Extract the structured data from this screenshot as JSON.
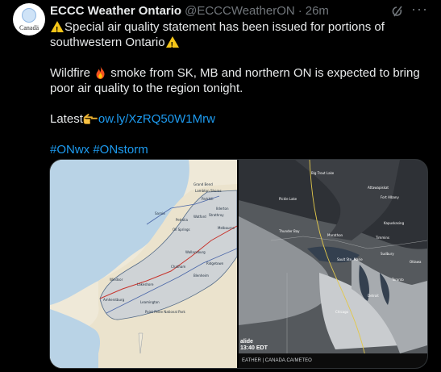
{
  "account": {
    "display_name": "ECCC Weather Ontario",
    "handle": "@ECCCWeatherON",
    "separator": "·",
    "timestamp": "26m",
    "avatar_brand": "Canadä"
  },
  "actions": {
    "grok_icon": "grok-icon",
    "more_icon": "more-icon",
    "more_glyph": "···"
  },
  "tweet": {
    "line1": "Special air quality statement has been issued for portions of",
    "line2": "southwestern Ontario",
    "para2_start": "Wildfire",
    "para2_rest": "smoke from SK, MB and northern ON is expected to bring poor air quality to the region tonight.",
    "latest_label": "Latest",
    "link": "ow.ly/XzRQ50W1Mrw",
    "hashtags": "#ONwx #ONstorm"
  },
  "media": {
    "map_places": [
      "Grand Bend",
      "Lambton Shores",
      "Parkhill",
      "Sarnia",
      "Petrolia",
      "Strathroy",
      "Oil Springs",
      "Watford",
      "Ilderton",
      "Melbourne",
      "Wallaceburg",
      "Chatham",
      "Ridgetown",
      "Blenheim",
      "Windsor",
      "Lakeshore",
      "Amherstburg",
      "Leamington",
      "Point Pelee National Park"
    ],
    "sat_places": [
      "Big Trout Lake",
      "Attawapiskat",
      "Pickle Lake",
      "Fort Albany",
      "Kapuskasing",
      "Timmins",
      "Thunder Bay",
      "Marathon",
      "Sault Ste. Marie",
      "Sudbury",
      "Ottawa",
      "Toronto",
      "Detroit",
      "Chicago"
    ],
    "sat_caption_line1": "alide",
    "sat_caption_line2": "13:40 EDT",
    "sat_footer": "EATHER  |  CANADA.CA/METEO"
  },
  "colors": {
    "link": "#1d9bf0",
    "muted": "#71767b",
    "text": "#e7e9ea",
    "warning": "#f5c518"
  }
}
